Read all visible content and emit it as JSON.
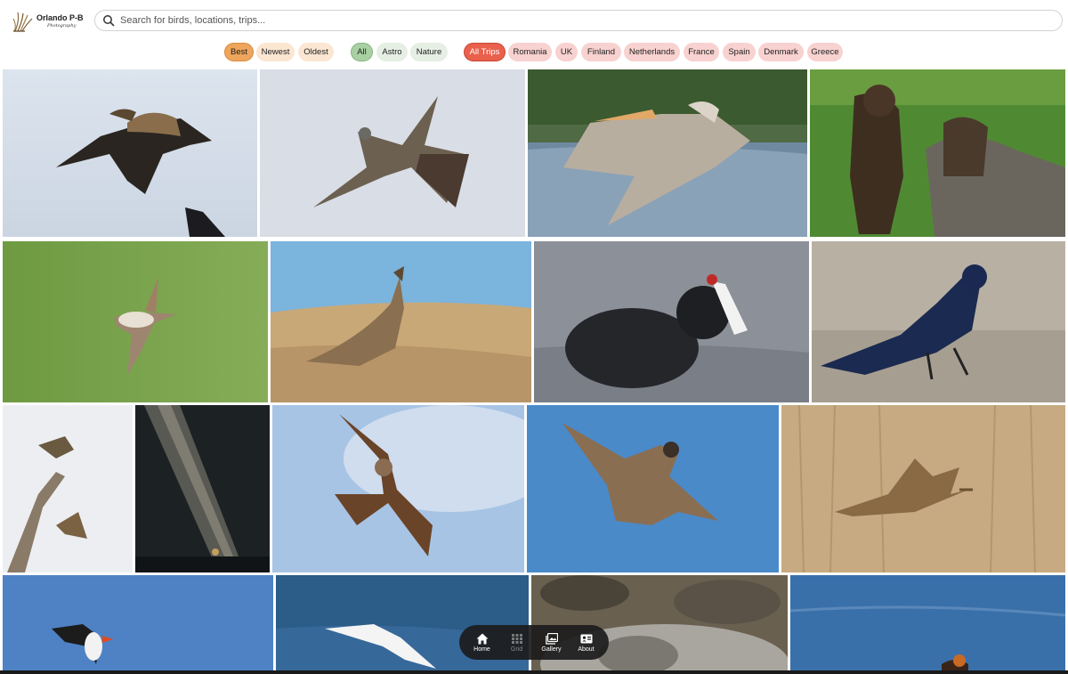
{
  "brand": {
    "title": "Orlando P-B",
    "subtitle": "Photography"
  },
  "search": {
    "placeholder": "Search for birds, locations, trips..."
  },
  "filters": {
    "sort": [
      {
        "label": "Best",
        "active": true
      },
      {
        "label": "Newest",
        "active": false
      },
      {
        "label": "Oldest",
        "active": false
      }
    ],
    "categories": [
      {
        "label": "All",
        "active": true
      },
      {
        "label": "Astro",
        "active": false
      },
      {
        "label": "Nature",
        "active": false
      }
    ],
    "trips": [
      {
        "label": "All Trips",
        "active": true
      },
      {
        "label": "Romania",
        "active": false
      },
      {
        "label": "UK",
        "active": false
      },
      {
        "label": "Finland",
        "active": false
      },
      {
        "label": "Netherlands",
        "active": false
      },
      {
        "label": "France",
        "active": false
      },
      {
        "label": "Spain",
        "active": false
      },
      {
        "label": "Denmark",
        "active": false
      },
      {
        "label": "Greece",
        "active": false
      }
    ]
  },
  "photos": [
    "eagle",
    "cuckoo",
    "pelican",
    "bears",
    "shrike",
    "lark",
    "coot",
    "grackle",
    "finches",
    "milky-way",
    "kite",
    "falcon",
    "bittern",
    "puffin",
    "tern",
    "seal",
    "grebe"
  ],
  "nav": [
    {
      "label": "Home",
      "icon": "home-icon",
      "active": true
    },
    {
      "label": "Grid",
      "icon": "grid-icon",
      "active": false
    },
    {
      "label": "Gallery",
      "icon": "gallery-icon",
      "active": true
    },
    {
      "label": "About",
      "icon": "id-card-icon",
      "active": true
    }
  ],
  "colors": {
    "sort_active": "#eea55c",
    "category_active": "#a8d0a2",
    "trip_active": "#e9604c",
    "nav_bg": "#1c1c1c"
  }
}
